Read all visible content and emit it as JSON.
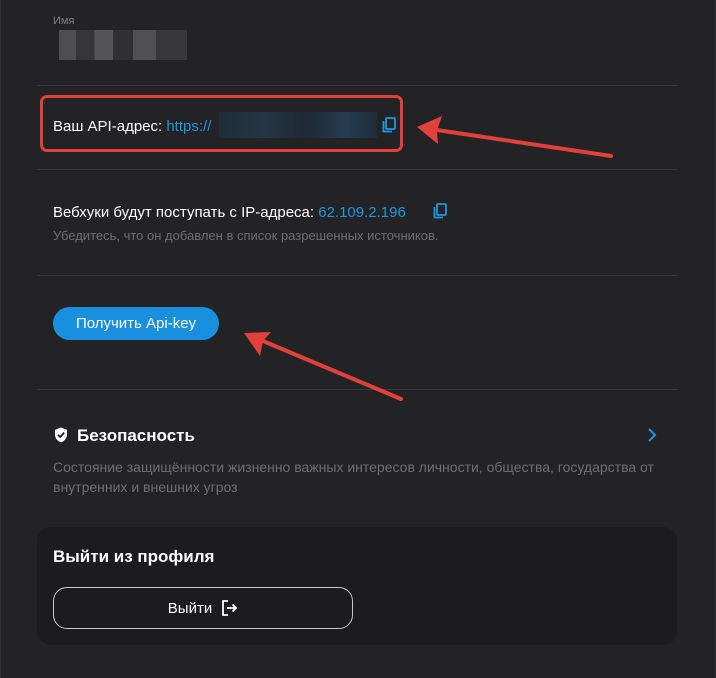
{
  "profile": {
    "name_label": "Имя"
  },
  "api": {
    "prefix": "Ваш API-адрес:",
    "url_visible": "https://"
  },
  "webhooks": {
    "text": "Вебхуки будут поступать с IP-адреса:",
    "ip": "62.109.2.196",
    "hint": "Убедитесь, что он добавлен в список разрешенных источников."
  },
  "apikey_button": "Получить Api-key",
  "security": {
    "title": "Безопасность",
    "description": "Состояние защищённости жизненно важных интересов личности, общества, государства от внутренних и внешних угроз"
  },
  "logout": {
    "title": "Выйти из профиля",
    "button": "Выйти"
  },
  "colors": {
    "accent": "#1990dd",
    "link": "#1f97e0",
    "highlight": "#e2413b",
    "background": "#232325"
  }
}
